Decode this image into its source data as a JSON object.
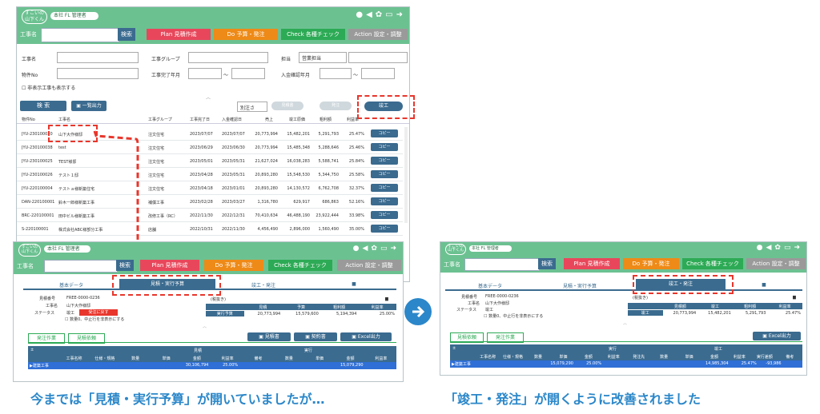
{
  "app": {
    "logo": "すこいの\n山下くん",
    "user": "本社 FL 管理者"
  },
  "nav": {
    "kouji_label": "工事名",
    "search_btn": "検索",
    "plan": "Plan 見積作成",
    "do": "Do 予算・発注",
    "check": "Check 各種チェック",
    "action": "Action 設定・調整"
  },
  "filters": {
    "kouji": "工事名",
    "group": "工事グループ",
    "tantou": "担当",
    "tantou_val": "営業担当",
    "bukken": "物件No",
    "kanryo": "工事完了年月",
    "nyukin": "入金確認年月",
    "tilde": "〜",
    "hidden_cb": "非表示工事も表示する"
  },
  "actions": {
    "search": "検 索",
    "export": "一覧出力",
    "sort": "別注さ",
    "dummy1": "見積書",
    "dummy2": "発注",
    "kanko": "竣工"
  },
  "table": {
    "headers": [
      "物件No",
      "工事名",
      "工事グループ",
      "工事完了日",
      "入金確認日",
      "売上",
      "竣工原価",
      "粗利額",
      "利益率"
    ],
    "rows": [
      [
        "JYU-230100030",
        "山下大作様邸",
        "注文住宅",
        "2023/07/07",
        "2023/07/07",
        "20,773,994",
        "15,482,201",
        "5,291,793",
        "25.47%"
      ],
      [
        "JYU-230100038",
        "test",
        "注文住宅",
        "2023/06/29",
        "2023/06/30",
        "20,773,994",
        "15,485,348",
        "5,288,646",
        "25.46%"
      ],
      [
        "JYU-230100025",
        "TEST様邸",
        "注文住宅",
        "2023/05/01",
        "2023/05/31",
        "21,627,024",
        "16,038,283",
        "5,588,741",
        "25.84%"
      ],
      [
        "JYU-230100026",
        "テスト１邸",
        "注文住宅",
        "2023/04/28",
        "2023/05/31",
        "20,893,280",
        "15,548,530",
        "5,344,750",
        "25.58%"
      ],
      [
        "JYU-220100004",
        "テストａ様新築住宅",
        "注文住宅",
        "2023/04/18",
        "2023/01/01",
        "20,893,280",
        "14,130,572",
        "6,762,708",
        "32.37%"
      ],
      [
        "DAN-220100001",
        "鈴木一郎様新築工事",
        "補償工事",
        "2023/02/28",
        "2023/03/27",
        "1,316,780",
        "629,917",
        "686,863",
        "52.16%"
      ],
      [
        "BRC-220100001",
        "田中ビル様新築工事",
        "改修工事（RC）",
        "2022/11/30",
        "2022/12/31",
        "70,410,634",
        "46,488,190",
        "23,922,444",
        "33.98%"
      ],
      [
        "S-220100001",
        "株式会社ABC様部分工事",
        "店舗",
        "2022/10/31",
        "2022/11/30",
        "4,456,490",
        "2,896,000",
        "1,560,490",
        "35.00%"
      ]
    ],
    "copy": "コピー"
  },
  "detail": {
    "tabs": [
      "基本データ",
      "見積・実行予算",
      "竣工・発注"
    ],
    "bukken_lbl": "見積番号",
    "bukken_val": "FREE-0000-0236",
    "kouji_lbl": "工事名",
    "kouji_val": "山下大作様邸",
    "status_lbl": "ステータス",
    "status_val": "竣工",
    "status_badge": "受注に戻す",
    "check": "数量0、中止行を非表示にする",
    "sort": "(税抜き)",
    "sum_headers": [
      "見積",
      "予算",
      "粗利額",
      "利益率"
    ],
    "sum_row_lbl": "実行予算",
    "sum_vals": [
      "20,773,994",
      "15,579,600",
      "5,194,394",
      "25.00%"
    ],
    "sum2_headers": [
      "見積額",
      "竣工",
      "粗利額",
      "利益率"
    ],
    "sum2_row_lbl": "竣工",
    "sum2_vals": [
      "20,773,994",
      "15,482,201",
      "5,291,793",
      "25.47%"
    ],
    "sub_tabs": [
      "発注作業",
      "見積依頼"
    ],
    "sub_tabs2": [
      "見積依頼",
      "発注作業"
    ],
    "buttons": [
      "見積書",
      "契約書",
      "Excel出力"
    ],
    "excel": "Excel出力",
    "grid_group1": "見積",
    "grid_group2": "実行",
    "grid_group3": "竣工",
    "grid_cols": [
      "工事名称",
      "仕様・規格",
      "数量",
      "単価",
      "金額",
      "利益率",
      "備考",
      "数量",
      "単価",
      "金額",
      "利益率"
    ],
    "grid2_cols": [
      "工事名称",
      "仕様・規格",
      "数量",
      "単価",
      "金額",
      "利益率",
      "発注先",
      "数量",
      "単価",
      "金額",
      "利益率",
      "実行差額",
      "備考"
    ],
    "total_lbl": "▶建築工事",
    "total_vals": [
      "30,106,794",
      "25.00%",
      "15,079,290"
    ],
    "total2_vals": [
      "15,079,290",
      "25.00%",
      "14,985,304",
      "25.47%",
      "-93,986"
    ]
  },
  "captions": {
    "before": "今までは「見積・実行予算」が開いていましたが…",
    "after": "「竣工・発注」が開くように改善されました"
  },
  "colors": {
    "green": "#6cc191",
    "navy": "#3b6b8f",
    "plan": "#e8475b",
    "do": "#ee8a17",
    "check": "#2daa55",
    "action": "#9a9a9a",
    "red": "#e8362c",
    "caption": "#2b87c9"
  }
}
